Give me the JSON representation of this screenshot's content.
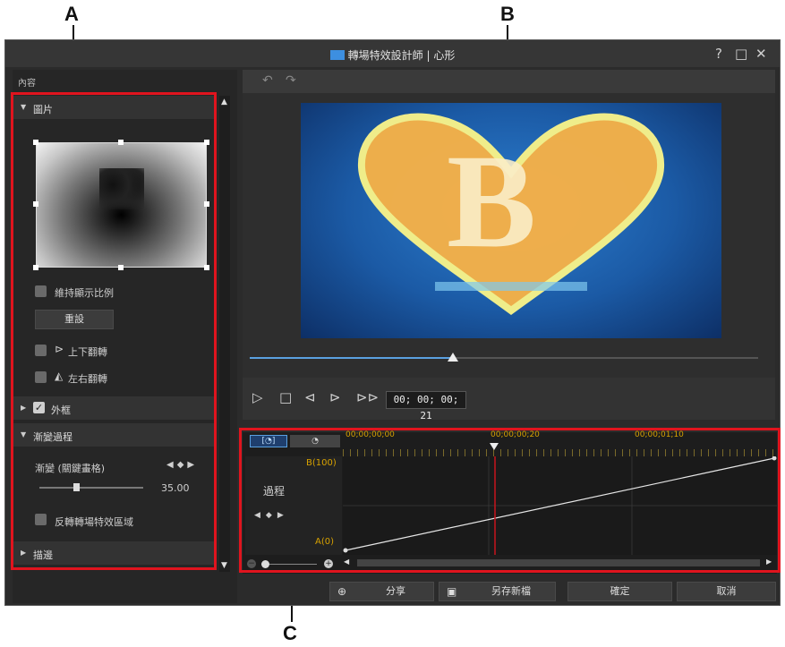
{
  "callouts": {
    "a": "A",
    "b": "B",
    "c": "C"
  },
  "window": {
    "title": "轉場特效設計師 | 心形",
    "help": "?",
    "maximize": "□",
    "close": "✕"
  },
  "left_panel": {
    "header": "內容",
    "image_section": "圖片",
    "keep_ratio": "維持顯示比例",
    "reset": "重設",
    "flip_vertical": "上下翻轉",
    "flip_horizontal": "左右翻轉",
    "frame_section": "外框",
    "progress_section": "漸變過程",
    "gradient_label": "漸變 (關鍵畫格)",
    "gradient_value": "35.00",
    "gradient_level": 0.35,
    "invert_label": "反轉轉場特效區域",
    "stroke_section": "描邊"
  },
  "preview": {
    "letter": "B",
    "timecode": "00; 00; 00; 21",
    "progress": 0.4
  },
  "timeline": {
    "times": [
      "00;00;00;00",
      "00;00;00;20",
      "00;00;01;10"
    ],
    "y_top": "B(100)",
    "y_bottom": "A(0)",
    "track_label": "過程"
  },
  "footer": {
    "share": "分享",
    "save_as": "另存新檔",
    "ok": "確定",
    "cancel": "取消"
  },
  "colors": {
    "highlight": "#e0141e",
    "accent": "#5aa0e0",
    "timeline_text": "#d8a200"
  }
}
